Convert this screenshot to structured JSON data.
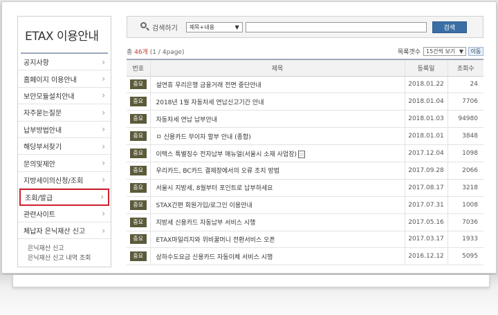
{
  "sidebar": {
    "title": "ETAX 이용안내",
    "items": [
      {
        "label": "공지사항"
      },
      {
        "label": "홈페이지 이용안내"
      },
      {
        "label": "보안모듈설치안내"
      },
      {
        "label": "자주묻는질문"
      },
      {
        "label": "납부방법안내"
      },
      {
        "label": "해당부서찾기"
      },
      {
        "label": "문의및제안"
      },
      {
        "label": "지방세이의신청/조회"
      },
      {
        "label": "조회/발급",
        "active": true
      },
      {
        "label": "관련사이트"
      },
      {
        "label": "체납자 은닉재산 신고"
      }
    ],
    "subitems": [
      "은닉재산 신고",
      "은닉재산 신고 내역 조회"
    ]
  },
  "search": {
    "label": "검색하기",
    "select_value": "제목+내용",
    "input_value": "",
    "button_label": "검색"
  },
  "list": {
    "total_prefix": "총",
    "total_count": "46개",
    "page_info": "(1 / 4page)",
    "page_size_label": "목록갯수",
    "page_size_value": "15건씩 보기",
    "move_label": "이동"
  },
  "table": {
    "headers": [
      "번호",
      "제목",
      "등록일",
      "조회수"
    ],
    "rows": [
      {
        "badge": "중요",
        "title": "설연휴 우리은행 금융거래 전면 중단안내",
        "date": "2018.01.22",
        "views": "24"
      },
      {
        "badge": "중요",
        "title": "2018년 1월 자동차세 연납신고기간 안내",
        "date": "2018.01.04",
        "views": "7706"
      },
      {
        "badge": "중요",
        "title": "자동차세 연납 납부안내",
        "date": "2018.01.03",
        "views": "94980"
      },
      {
        "badge": "중요",
        "title": "ㅁ 신용카드 무이자 할부 안내 (종합)",
        "date": "2018.01.01",
        "views": "3848"
      },
      {
        "badge": "중요",
        "title": "이택스 특별징수 전자납부 매뉴얼(서울시 소재 사업장)",
        "date": "2017.12.04",
        "views": "1098",
        "attachment": true
      },
      {
        "badge": "중요",
        "title": "우리카드, BC카드 결제창에서의 오류 조치 방법",
        "date": "2017.09.28",
        "views": "2066"
      },
      {
        "badge": "중요",
        "title": "서울시 지방세, 8월부터 포인트로 납부하세요",
        "date": "2017.08.17",
        "views": "3218"
      },
      {
        "badge": "중요",
        "title": "STAX간편 회원가입/로그인 이용안내",
        "date": "2017.07.31",
        "views": "1008"
      },
      {
        "badge": "중요",
        "title": "지방세 신용카드 자동납부 서비스 시행",
        "date": "2017.05.16",
        "views": "7036"
      },
      {
        "badge": "중요",
        "title": "ETAX마일리지와 위비꿀머니 전환서비스 오픈",
        "date": "2017.03.17",
        "views": "1933"
      },
      {
        "badge": "중요",
        "title": "상하수도요금 신용카드 자동이체 서비스 시행",
        "date": "2016.12.12",
        "views": "5095"
      }
    ]
  }
}
